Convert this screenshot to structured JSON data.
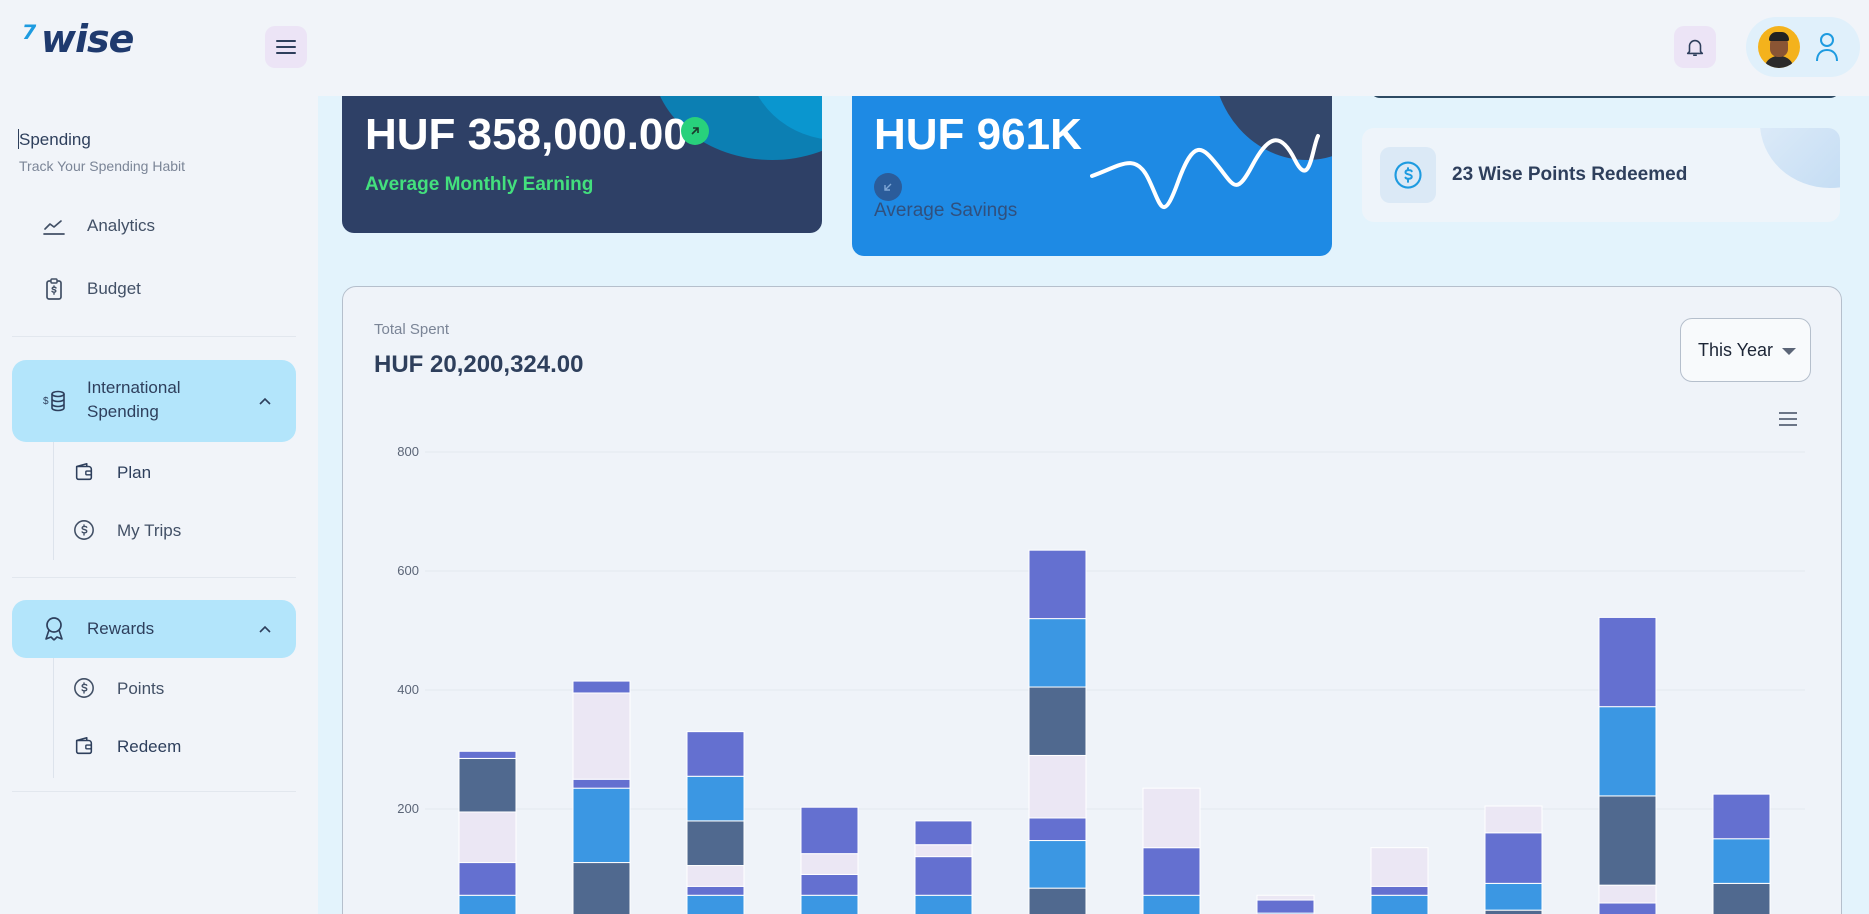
{
  "brand": {
    "logo_mark": "⁷",
    "logo_text": "wise",
    "brand_color": "#1e9be0"
  },
  "sidebar": {
    "title": "Spending",
    "subtitle": "Track Your Spending Habit",
    "items": [
      {
        "label": "Analytics",
        "icon": "line-chart-icon"
      },
      {
        "label": "Budget",
        "icon": "clipboard-dollar-icon"
      }
    ],
    "groups": [
      {
        "label_line1": "International",
        "label_line2": "Spending",
        "icon": "coins-icon",
        "expanded": true,
        "subitems": [
          {
            "label": "Plan",
            "icon": "wallet-icon"
          },
          {
            "label": "My Trips",
            "icon": "dollar-circle-icon"
          }
        ]
      },
      {
        "label": "Rewards",
        "icon": "award-icon",
        "expanded": true,
        "subitems": [
          {
            "label": "Points",
            "icon": "dollar-circle-icon"
          },
          {
            "label": "Redeem",
            "icon": "wallet-icon"
          }
        ]
      }
    ]
  },
  "cards": {
    "earning": {
      "value": "HUF 358,000.00",
      "caption": "Average Monthly Earning",
      "trend": "up"
    },
    "savings": {
      "value": "HUF 961K",
      "caption": "Average Savings",
      "trend": "down"
    },
    "points": {
      "text": "23 Wise Points Redeemed"
    }
  },
  "spending": {
    "label": "Total Spent",
    "total": "HUF 20,200,324.00",
    "period": "This Year"
  },
  "chart_data": {
    "type": "bar",
    "stacked": true,
    "ylim": [
      0,
      800
    ],
    "yticks": [
      "800",
      "600",
      "400",
      "200"
    ],
    "colors": [
      "#50698f",
      "#3b97e3",
      "#6470d0",
      "#ebe7f4"
    ],
    "columns": [
      [
        {
          "c": 0,
          "v": 20
        },
        {
          "c": 1,
          "v": 35
        },
        {
          "c": 2,
          "v": 55
        },
        {
          "c": 3,
          "v": 85
        },
        {
          "c": 0,
          "v": 90
        },
        {
          "c": 2,
          "v": 12
        }
      ],
      [
        {
          "c": 0,
          "v": 110
        },
        {
          "c": 1,
          "v": 125
        },
        {
          "c": 2,
          "v": 15
        },
        {
          "c": 3,
          "v": 145
        },
        {
          "c": 2,
          "v": 20
        }
      ],
      [
        {
          "c": 0,
          "v": 20
        },
        {
          "c": 1,
          "v": 35
        },
        {
          "c": 2,
          "v": 15
        },
        {
          "c": 3,
          "v": 35
        },
        {
          "c": 0,
          "v": 75
        },
        {
          "c": 1,
          "v": 75
        },
        {
          "c": 2,
          "v": 75
        }
      ],
      [
        {
          "c": 0,
          "v": 20
        },
        {
          "c": 1,
          "v": 35
        },
        {
          "c": 2,
          "v": 35
        },
        {
          "c": 3,
          "v": 35
        },
        {
          "c": 2,
          "v": 78
        }
      ],
      [
        {
          "c": 0,
          "v": 20
        },
        {
          "c": 1,
          "v": 35
        },
        {
          "c": 2,
          "v": 65
        },
        {
          "c": 3,
          "v": 20
        },
        {
          "c": 2,
          "v": 40
        }
      ],
      [
        {
          "c": 0,
          "v": 67
        },
        {
          "c": 1,
          "v": 80
        },
        {
          "c": 2,
          "v": 38
        },
        {
          "c": 3,
          "v": 105
        },
        {
          "c": 0,
          "v": 115
        },
        {
          "c": 1,
          "v": 115
        },
        {
          "c": 2,
          "v": 115
        }
      ],
      [
        {
          "c": 0,
          "v": 20
        },
        {
          "c": 1,
          "v": 35
        },
        {
          "c": 2,
          "v": 80
        },
        {
          "c": 3,
          "v": 100
        }
      ],
      [
        {
          "c": 0,
          "v": 5
        },
        {
          "c": 1,
          "v": 20
        },
        {
          "c": 2,
          "v": 22
        },
        {
          "c": 3,
          "v": 8
        }
      ],
      [
        {
          "c": 0,
          "v": 20
        },
        {
          "c": 1,
          "v": 35
        },
        {
          "c": 2,
          "v": 15
        },
        {
          "c": 3,
          "v": 65
        }
      ],
      [
        {
          "c": 0,
          "v": 30
        },
        {
          "c": 1,
          "v": 45
        },
        {
          "c": 2,
          "v": 85
        },
        {
          "c": 3,
          "v": 45
        }
      ],
      [
        {
          "c": 1,
          "v": 20
        },
        {
          "c": 2,
          "v": 22
        },
        {
          "c": 3,
          "v": 30
        },
        {
          "c": 0,
          "v": 150
        },
        {
          "c": 1,
          "v": 150
        },
        {
          "c": 2,
          "v": 150
        }
      ],
      [
        {
          "c": 0,
          "v": 75
        },
        {
          "c": 1,
          "v": 75
        },
        {
          "c": 2,
          "v": 75
        }
      ]
    ]
  }
}
